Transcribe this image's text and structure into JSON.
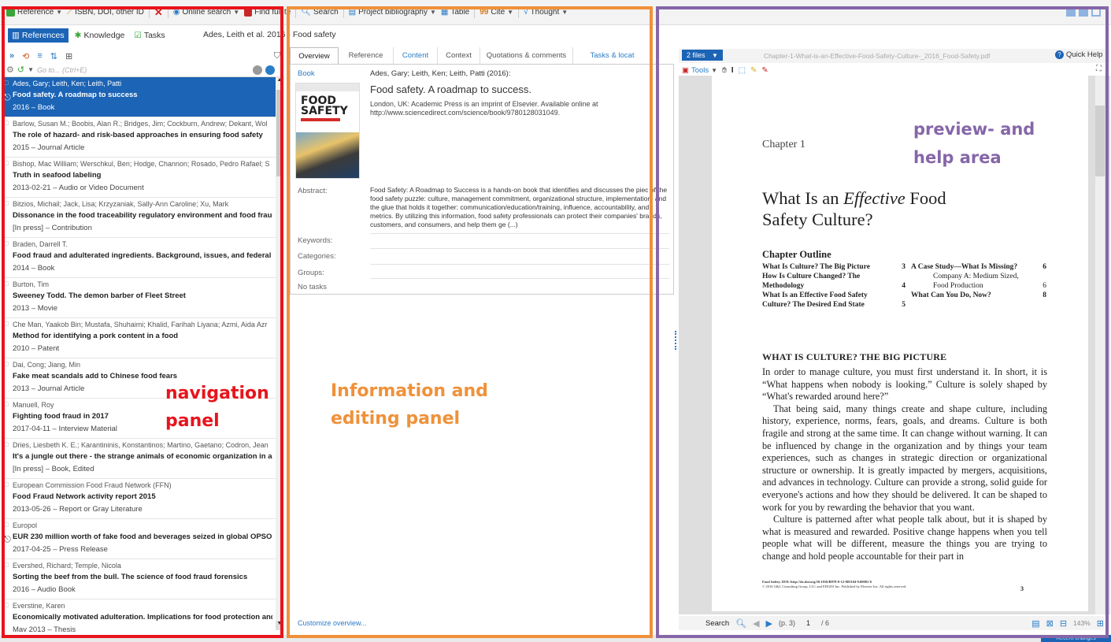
{
  "toolbar": {
    "reference": "Reference",
    "isbn": "ISBN, DOI, other ID",
    "online_search": "Online search",
    "find_full_text": "Find full te",
    "search": "Search",
    "project_bibliography": "Project bibliography",
    "table": "Table",
    "cite": "Cite",
    "thought": "Thought"
  },
  "nav_tabs": {
    "references": "References",
    "knowledge": "Knowledge",
    "tasks": "Tasks"
  },
  "breadcrumb": "Ades, Leith et al. 2016 - Food safety",
  "goto_placeholder": "Go to... (Ctrl+E)",
  "references": [
    {
      "authors": "Ades, Gary; Leith, Ken; Leith, Patti",
      "title": "Food safety. A roadmap to success",
      "meta": "2016 – Book",
      "selected": true,
      "clip": true
    },
    {
      "authors": "Barlow, Susan M.; Boobis, Alan R.; Bridges, Jim; Cockburn, Andrew; Dekant, Wol",
      "title": "The role of hazard- and risk-based approaches in ensuring food safety",
      "meta": "2015 – Journal Article"
    },
    {
      "authors": "Bishop, Mac William; Werschkul, Ben; Hodge, Channon; Rosado, Pedro Rafael; S",
      "title": "Truth in seafood labeling",
      "meta": "2013-02-21 – Audio or Video Document"
    },
    {
      "authors": "Bitzios, Michail; Jack, Lisa; Krzyzaniak, Sally-Ann Caroline; Xu, Mark",
      "title": "Dissonance in the food traceability regulatory environment and food fraud",
      "meta": "[In press] – Contribution"
    },
    {
      "authors": "Braden, Darrell T.",
      "title": "Food fraud and adulterated ingredients. Background, issues, and federal actio",
      "meta": "2014 – Book"
    },
    {
      "authors": "Burton, Tim",
      "title": "Sweeney Todd. The demon barber of Fleet Street",
      "meta": "2013 – Movie"
    },
    {
      "authors": "Che Man, Yaakob Bin; Mustafa, Shuhaimi; Khalid, Farihah Liyana; Azmi, Aida Azr",
      "title": "Method for identifying a pork content in a food",
      "meta": "2010 – Patent"
    },
    {
      "authors": "Dai, Cong; Jiang, Min",
      "title": "Fake meat scandals add to Chinese food fears",
      "meta": "2013 – Journal Article"
    },
    {
      "authors": "Manuell, Roy",
      "title": "Fighting food fraud in 2017",
      "meta": "2017-04-11 – Interview Material"
    },
    {
      "authors": "Dries, Liesbeth K. E.; Karantininis, Konstantinos; Martino, Gaetano; Codron, Jean",
      "title": "It's a jungle out there - the strange animals of economic organization in agri-f",
      "meta": "[In press] – Book, Edited"
    },
    {
      "authors": "European Commission Food Fraud Network (FFN)",
      "title": "Food Fraud Network activity report 2015",
      "meta": "2013-05-26 – Report or Gray Literature"
    },
    {
      "authors": "Europol",
      "title": "EUR 230 million worth of fake food and beverages seized in global OPSON op",
      "meta": "2017-04-25 – Press Release",
      "clip": true
    },
    {
      "authors": "Evershed, Richard; Temple, Nicola",
      "title": "Sorting the beef from the bull. The science of food fraud forensics",
      "meta": "2016 – Audio Book"
    },
    {
      "authors": "Everstine, Karen",
      "title": "Economically motivated adulteration. Implications for food protection and alt",
      "meta": "May 2013 – Thesis"
    }
  ],
  "info": {
    "tabs": [
      "Overview",
      "Reference",
      "Content",
      "Context",
      "Quotations & comments",
      "Tasks & locat"
    ],
    "type": "Book",
    "authors_line": "Ades, Gary; Leith, Ken; Leith, Patti (2016):",
    "title": "Food safety. A roadmap to success.",
    "publisher": "London, UK: Academic Press is an imprint of Elsevier. Available online at http://www.sciencedirect.com/science/book/9780128031049.",
    "cover_title_1": "FOOD",
    "cover_title_2": "SAFETY",
    "abstract_label": "Abstract:",
    "abstract": "Food Safety: A Roadmap to Success is a hands-on book that identifies and discusses the piec of the food safety puzzle: culture, management commitment, organizational structure, implementation, and the glue that holds it together: communication/education/training, influence, accountability, and metrics. By utilizing this information, food safety professionals can protect their companies' brands, customers, and consumers, and help them ge (...)",
    "keywords_label": "Keywords:",
    "categories_label": "Categories:",
    "groups_label": "Groups:",
    "tasks_label": "No tasks",
    "customize": "Customize overview..."
  },
  "preview": {
    "files_btn": "2 files",
    "file_name": "Chapter-1-What-is-an-Effective-Food-Safety-Culture-_2016_Food-Safety.pdf",
    "quick_help": "Quick Help",
    "tools": "Tools",
    "search": "Search",
    "page_label": "(p. 3)",
    "page_num": "1",
    "page_total": "/ 6",
    "zoom": "143%"
  },
  "pdf": {
    "chapter": "Chapter 1",
    "heading_1": "What Is an ",
    "heading_em": "Effective",
    "heading_2": " Food",
    "heading_3": "Safety Culture?",
    "outline_title": "Chapter Outline",
    "outline_left": [
      {
        "t": "What Is Culture? The Big Picture",
        "p": "3"
      },
      {
        "t": "How Is Culture Changed? The",
        "p": ""
      },
      {
        "t": "Methodology",
        "p": "4"
      },
      {
        "t": "What Is an Effective Food Safety",
        "p": ""
      },
      {
        "t": "Culture? The Desired End State",
        "p": "5"
      }
    ],
    "outline_right": [
      {
        "t": "A Case Study—What Is Missing?",
        "p": "6",
        "sub": false
      },
      {
        "t": "Company A: Medium Sized,",
        "p": "",
        "sub": true
      },
      {
        "t": "Food Production",
        "p": "6",
        "sub": true
      },
      {
        "t": "What Can You Do, Now?",
        "p": "8",
        "sub": false
      }
    ],
    "section": "WHAT IS CULTURE? THE BIG PICTURE",
    "para1": "In order to manage culture, you must first understand it. In short, it is “What happens when nobody is looking.” Culture is solely shaped by “What's rewarded around here?”",
    "para2": "That being said, many things create and shape culture, including history, experience, norms, fears, goals, and dreams. Culture is both fragile and strong at the same time. It can change without warning. It can be influenced by change in the organization and by things your team experiences, such as changes in strategic direction or organizational structure or ownership. It is greatly impacted by mergers, acquisitions, and advances in technology. Culture can provide a strong, solid guide for everyone's actions and how they should be delivered. It can be shaped to work for you by rewarding the behavior that you want.",
    "para3": "Culture is patterned after what people talk about, but it is shaped by what is measured and rewarded. Positive change happens when you tell people what will be different, measure the things you are trying to change and hold people accountable for their part in",
    "footer_1": "Food Safety. DOI: http://dx.doi.org/10.1016/B978-0-12-803104-9.00001-6",
    "footer_2": "© 2016 G&L Consulting Group, LLC and EDGES Inc. Published by Elsevier Inc. All rights reserved.",
    "page_no": "3"
  },
  "annotations": {
    "nav_1": "navigation",
    "nav_2": "panel",
    "info_1": "Information and",
    "info_2": "editing panel",
    "preview_1": "preview- and",
    "preview_2": "help area"
  },
  "colors": {
    "nav_border": "#e8141c",
    "info_border": "#f0913a",
    "preview_border": "#8566a8",
    "selection": "#1c64b5",
    "accent": "#2f7bd6"
  },
  "statusbar": {
    "recent_changes": "Recent changes"
  }
}
